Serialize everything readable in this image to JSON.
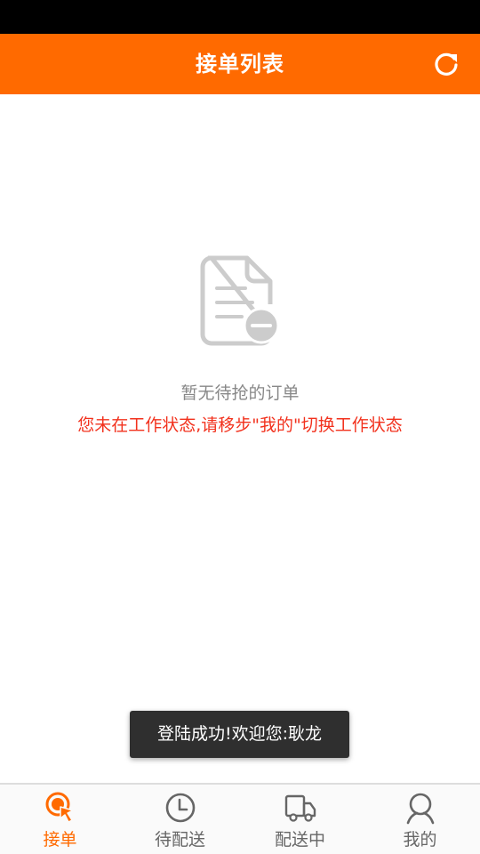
{
  "header": {
    "title": "接单列表"
  },
  "empty_state": {
    "message": "暂无待抢的订单",
    "warning": "您未在工作状态,请移步\"我的\"切换工作状态"
  },
  "toast": {
    "text": "登陆成功!欢迎您:耿龙"
  },
  "tabs": [
    {
      "label": "接单",
      "icon": "touch-pointer-icon",
      "active": true
    },
    {
      "label": "待配送",
      "icon": "clock-icon",
      "active": false
    },
    {
      "label": "配送中",
      "icon": "truck-icon",
      "active": false
    },
    {
      "label": "我的",
      "icon": "user-icon",
      "active": false
    }
  ],
  "colors": {
    "accent": "#ff6a00",
    "warning": "#f2311d",
    "status_bar": "#000000",
    "muted_text": "#888888",
    "tab_inactive": "#666666"
  }
}
